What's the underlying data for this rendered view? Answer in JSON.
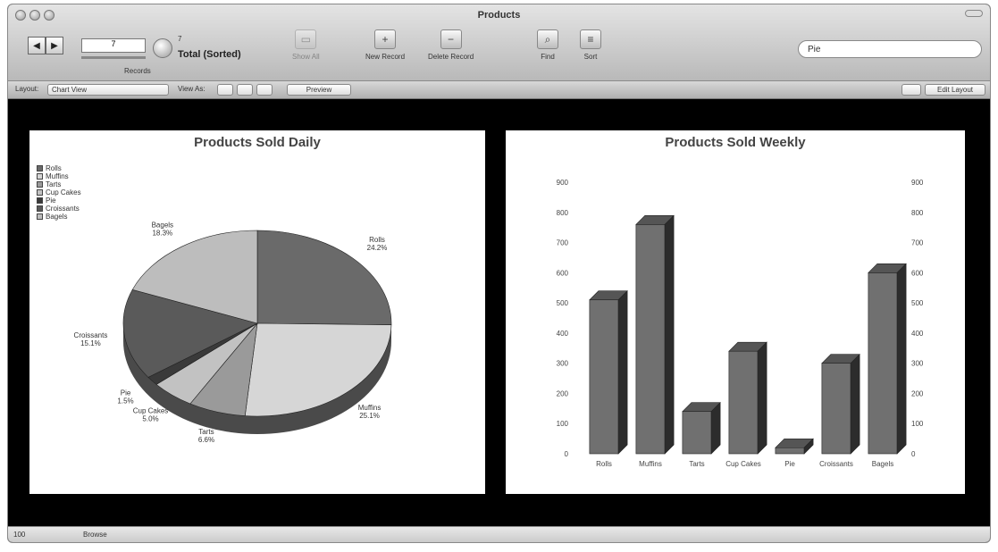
{
  "window": {
    "title": "Products"
  },
  "toolbar": {
    "records_label": "Records",
    "record_number": "7",
    "total_count": "7",
    "found_status": "Total (Sorted)",
    "items": [
      {
        "label": "Show All",
        "icon": "show-all-icon",
        "disabled": true
      },
      {
        "label": "New Record",
        "icon": "new-record-icon",
        "disabled": false
      },
      {
        "label": "Delete Record",
        "icon": "delete-record-icon",
        "disabled": false
      },
      {
        "label": "Find",
        "icon": "find-icon",
        "disabled": false
      },
      {
        "label": "Sort",
        "icon": "sort-icon",
        "disabled": false
      }
    ],
    "search_value": "Pie"
  },
  "layoutbar": {
    "layout_label": "Layout:",
    "layout_value": "Chart View",
    "view_as_label": "View As:",
    "preview_label": "Preview",
    "right_button_label": "Edit Layout"
  },
  "panels": {
    "daily_title": "Products Sold Daily",
    "weekly_title": "Products Sold Weekly"
  },
  "status": {
    "zoom": "100",
    "mode": "Browse"
  },
  "colors": {
    "window_bg": "#000000",
    "panel_bg": "#ffffff"
  },
  "chart_data": [
    {
      "type": "pie",
      "title": "Products Sold Daily",
      "legend": [
        "Rolls",
        "Muffins",
        "Tarts",
        "Cup Cakes",
        "Pie",
        "Croissants",
        "Bagels"
      ],
      "slices": [
        {
          "name": "Rolls",
          "value": 24.2
        },
        {
          "name": "Muffins",
          "value": 25.1
        },
        {
          "name": "Tarts",
          "value": 6.6
        },
        {
          "name": "Cup Cakes",
          "value": 5.0
        },
        {
          "name": "Pie",
          "value": 1.5
        },
        {
          "name": "Croissants",
          "value": 15.1
        },
        {
          "name": "Bagels",
          "value": 18.3
        }
      ],
      "slice_labels": [
        {
          "name": "Rolls",
          "pct": "24.2%"
        },
        {
          "name": "Muffins",
          "pct": "25.1%"
        },
        {
          "name": "Tarts",
          "pct": "6.6%"
        },
        {
          "name": "Cup Cakes",
          "pct": "5.0%"
        },
        {
          "name": "Pie",
          "pct": "1.5%"
        },
        {
          "name": "Croissants",
          "pct": "15.1%"
        },
        {
          "name": "Bagels",
          "pct": "18.3%"
        }
      ],
      "legend_placement": "top-left"
    },
    {
      "type": "bar",
      "title": "Products Sold Weekly",
      "categories": [
        "Rolls",
        "Muffins",
        "Tarts",
        "Cup Cakes",
        "Pie",
        "Croissants",
        "Bagels"
      ],
      "values": [
        510,
        760,
        140,
        340,
        20,
        300,
        600
      ],
      "ylim": [
        0,
        900
      ],
      "y_ticks": [
        "0",
        "100",
        "200",
        "300",
        "400",
        "500",
        "600",
        "700",
        "800",
        "900"
      ],
      "y2lim": [
        0,
        900
      ],
      "y2_ticks": [
        "0",
        "100",
        "200",
        "300",
        "400",
        "500",
        "600",
        "700",
        "800",
        "900"
      ],
      "grid": false
    }
  ]
}
